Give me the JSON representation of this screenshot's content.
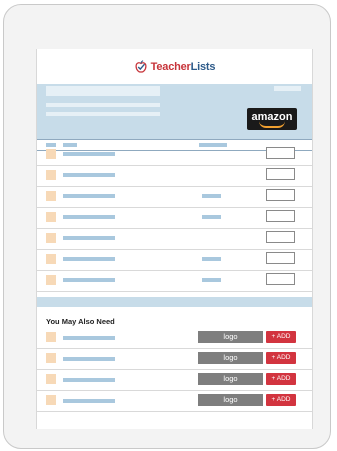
{
  "brand": {
    "name_part1": "Teacher",
    "name_part2": "Lists"
  },
  "hero": {
    "retailer": "amazon"
  },
  "list_rows": [
    {
      "has_mid": false
    },
    {
      "has_mid": false
    },
    {
      "has_mid": true
    },
    {
      "has_mid": true
    },
    {
      "has_mid": false
    },
    {
      "has_mid": true
    },
    {
      "has_mid": true
    }
  ],
  "section": {
    "title": "You May Also Need"
  },
  "recommendations": [
    {
      "logo_label": "logo",
      "add_label": "+ ADD"
    },
    {
      "logo_label": "logo",
      "add_label": "+ ADD"
    },
    {
      "logo_label": "logo",
      "add_label": "+ ADD"
    },
    {
      "logo_label": "logo",
      "add_label": "+ ADD"
    }
  ],
  "colors": {
    "brand_red": "#c7343a",
    "brand_blue": "#2e5b8a",
    "hero_bg": "#c7dce9",
    "placeholder": "#a9c8de",
    "checkbox_tan": "#f7d9b7",
    "add_red": "#d2343f",
    "logo_gray": "#7e7e7e"
  }
}
